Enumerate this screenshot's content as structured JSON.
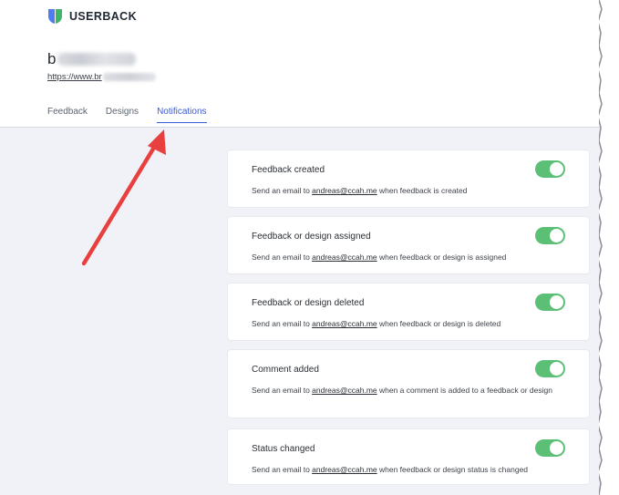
{
  "brand": {
    "name": "USERBACK",
    "logo_icon": "shield-logo-icon",
    "logo_colors": [
      "#4f7df0",
      "#3fb56a"
    ]
  },
  "site": {
    "name_prefix": "b",
    "url_prefix": "https://www.br"
  },
  "tabs": [
    {
      "label": "Feedback",
      "active": false
    },
    {
      "label": "Designs",
      "active": false
    },
    {
      "label": "Notifications",
      "active": true
    }
  ],
  "notifications": [
    {
      "title": "Feedback created",
      "desc_pre": "Send an email to ",
      "email": "andreas@ccah.me",
      "desc_post": " when feedback is created",
      "enabled": true
    },
    {
      "title": "Feedback or design assigned",
      "desc_pre": "Send an email to ",
      "email": "andreas@ccah.me",
      "desc_post": " when feedback or design is assigned",
      "enabled": true
    },
    {
      "title": "Feedback or design deleted",
      "desc_pre": "Send an email to ",
      "email": "andreas@ccah.me",
      "desc_post": " when feedback or design is deleted",
      "enabled": true
    },
    {
      "title": "Comment added",
      "desc_pre": "Send an email to ",
      "email": "andreas@ccah.me",
      "desc_post": " when a comment is added to a feedback or design",
      "enabled": true
    },
    {
      "title": "Status changed",
      "desc_pre": "Send an email to ",
      "email": "andreas@ccah.me",
      "desc_post": " when feedback or design status is changed",
      "enabled": true
    }
  ],
  "colors": {
    "accent": "#3b5bd6",
    "toggle_on": "#5cbf76",
    "annotation_arrow": "#e8403f"
  }
}
